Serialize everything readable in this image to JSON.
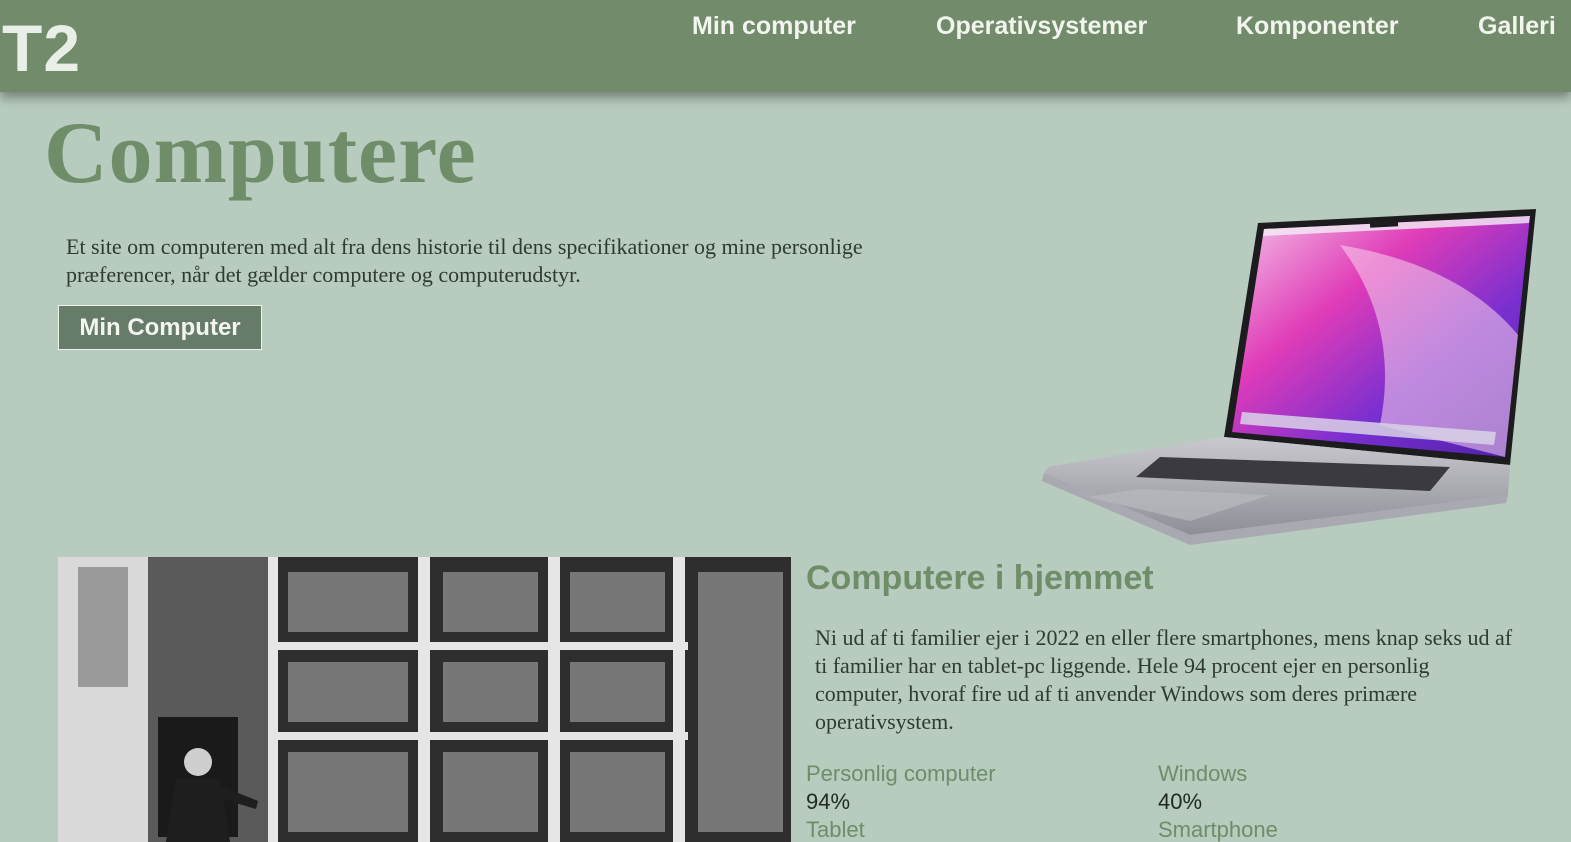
{
  "header": {
    "logo": "T2",
    "nav": [
      {
        "label": "Min computer"
      },
      {
        "label": "Operativsystemer"
      },
      {
        "label": "Komponenter"
      },
      {
        "label": "Galleri"
      }
    ]
  },
  "hero": {
    "title": "Computere",
    "intro": "Et site om computeren med alt fra dens historie til dens specifikationer og mine personlige præferencer, når det gælder computere og computerudstyr.",
    "button_label": "Min Computer"
  },
  "section": {
    "heading": "Computere i hjemmet",
    "body": "Ni ud af ti familier ejer i 2022 en eller flere smartphones, mens knap seks ud af ti familier har en tablet-pc liggende. Hele 94 procent ejer en personlig computer, hvoraf fire ud af ti anvender Windows som deres primære operativsystem.",
    "stats": [
      {
        "label": "Personlig computer",
        "value": "94%"
      },
      {
        "label": "Windows",
        "value": "40%"
      },
      {
        "label": "Tablet",
        "value": ""
      },
      {
        "label": "Smartphone",
        "value": ""
      }
    ]
  },
  "colors": {
    "background": "#b7cbbe",
    "header": "#718b6b",
    "accent": "#6e8d68",
    "button": "#667c69"
  },
  "icons": [
    "laptop-image",
    "mainframe-photo"
  ]
}
